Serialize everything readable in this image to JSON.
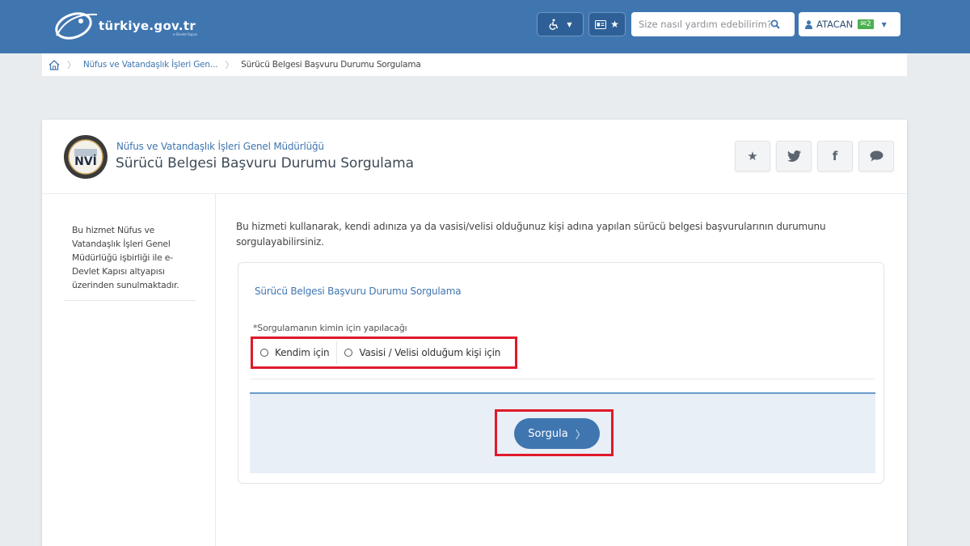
{
  "header": {
    "logo_text": "türkiye.gov.tr",
    "logo_subtext": "e-Devlet Kapısı",
    "search_placeholder": "Size nasıl yardım edebilirim?",
    "user_name": "ATACAN",
    "user_badge": "2"
  },
  "breadcrumb": {
    "items": [
      "Nüfus ve Vatandaşlık İşleri Gen...",
      "Sürücü Belgesi Başvuru Durumu Sorgulama"
    ]
  },
  "service": {
    "org_name": "Nüfus ve Vatandaşlık İşleri Genel Müdürlüğü",
    "title": "Sürücü Belgesi Başvuru Durumu Sorgulama",
    "logo_text": "NVİ"
  },
  "sidebar": {
    "note": "Bu hizmet Nüfus ve Vatandaşlık İşleri Genel Müdürlüğü işbirliği ile e-Devlet Kapısı altyapısı üzerinden sunulmaktadır."
  },
  "content": {
    "intro": "Bu hizmeti kullanarak, kendi adınıza ya da vasisi/velisi olduğunuz kişi adına yapılan sürücü belgesi başvurularının durumunu sorgulayabilirsiniz.",
    "form_title": "Sürücü Belgesi Başvuru Durumu Sorgulama",
    "field_label": "*Sorgulamanın kimin için yapılacağı",
    "options": [
      "Kendim için",
      "Vasisi / Velisi olduğum kişi için"
    ],
    "submit_label": "Sorgula"
  },
  "colors": {
    "header_blue": "#3f76b0",
    "highlight_red": "#e0192a",
    "badge_green": "#4caf50"
  }
}
